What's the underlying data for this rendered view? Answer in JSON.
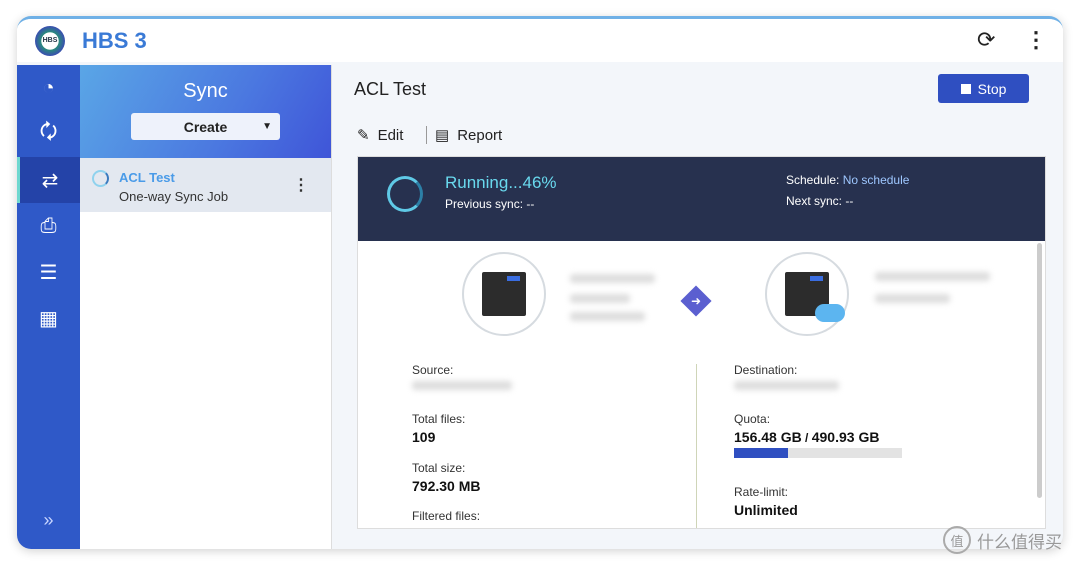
{
  "app": {
    "title": "HBS 3",
    "logo_text": "HBS"
  },
  "sidebar": {
    "title": "Sync",
    "create_label": "Create",
    "jobs": [
      {
        "name": "ACL Test",
        "type": "One-way Sync Job"
      }
    ]
  },
  "main": {
    "title": "ACL Test",
    "stop_label": "Stop",
    "edit_label": "Edit",
    "report_label": "Report",
    "status": "Running...46%",
    "progress_percent": 46,
    "previous_sync": "Previous sync: --",
    "schedule_label": "Schedule:",
    "schedule_value": "No schedule",
    "next_sync": "Next sync: --",
    "source_label": "Source:",
    "destination_label": "Destination:",
    "total_files_label": "Total files:",
    "total_files": "109",
    "total_size_label": "Total size:",
    "total_size": "792.30 MB",
    "filtered_label": "Filtered files:",
    "quota_label": "Quota:",
    "quota_used": "156.48 GB",
    "quota_sep": " / ",
    "quota_total": "490.93 GB",
    "quota_fraction": 0.319,
    "rate_label": "Rate-limit:",
    "rate_value": "Unlimited"
  },
  "watermark": "什么值得买"
}
